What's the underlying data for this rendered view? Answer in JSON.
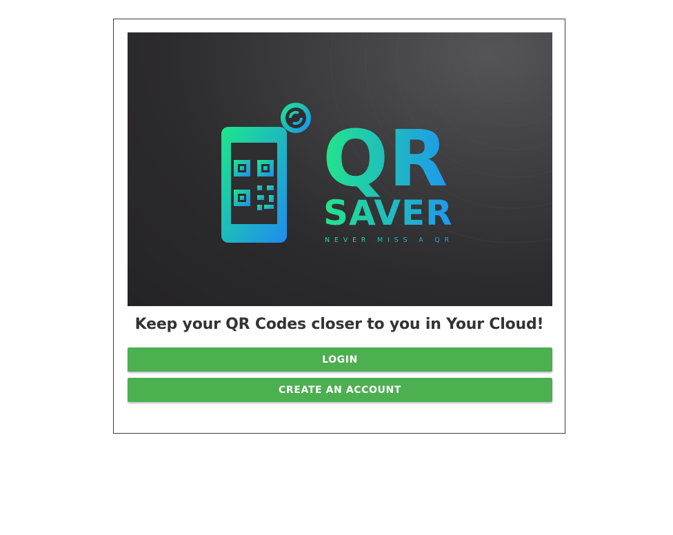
{
  "hero": {
    "logo_title": "QR",
    "logo_subtitle": "SAVER",
    "logo_slogan": "NEVER MISS A QR",
    "colors": {
      "gradient_start": "#1ee68a",
      "gradient_end": "#1e8cf0",
      "background": "#2e2d2f"
    }
  },
  "tagline": "Keep your QR Codes closer to you in Your Cloud!",
  "buttons": {
    "login_label": "LOGIN",
    "create_account_label": "CREATE AN ACCOUNT",
    "color": "#4caf50"
  }
}
